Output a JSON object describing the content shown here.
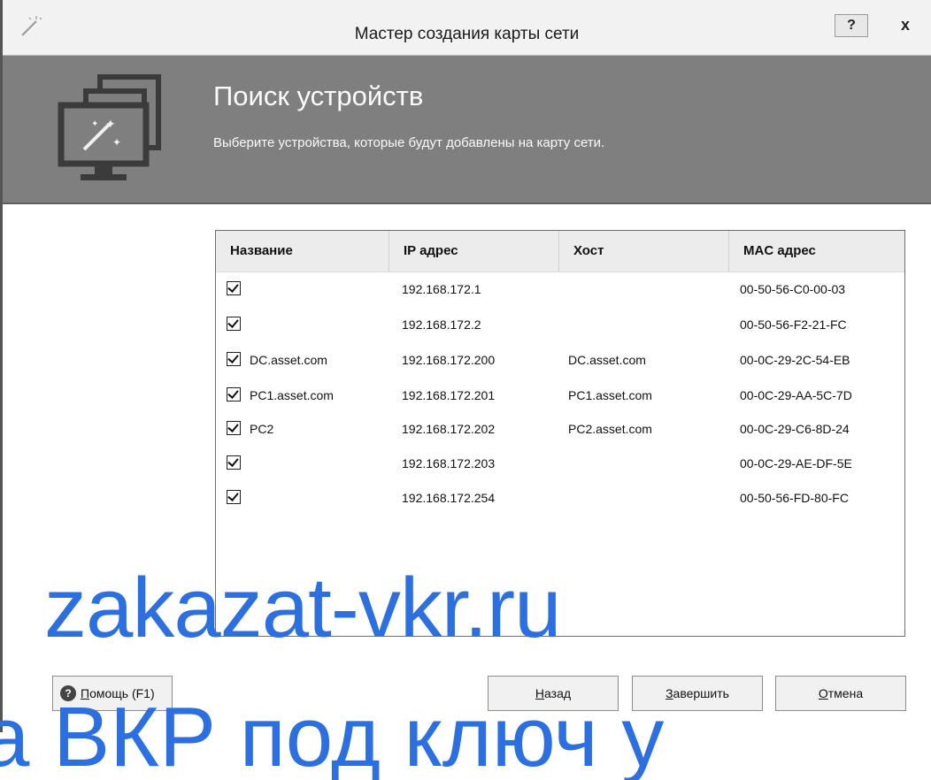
{
  "window": {
    "title": "Мастер создания карты сети",
    "help_button": "?",
    "close_button": "x"
  },
  "header": {
    "title": "Поиск устройств",
    "subtitle": "Выберите устройства, которые будут добавлены на карту сети."
  },
  "table": {
    "columns": [
      "Название",
      "IP адрес",
      "Хост",
      "MAC адрес"
    ],
    "rows": [
      {
        "checked": true,
        "name": "",
        "ip": "192.168.172.1",
        "host": "",
        "mac": "00-50-56-C0-00-03"
      },
      {
        "checked": true,
        "name": "",
        "ip": "192.168.172.2",
        "host": "",
        "mac": "00-50-56-F2-21-FC"
      },
      {
        "checked": true,
        "name": "DC.asset.com",
        "ip": "192.168.172.200",
        "host": "DC.asset.com",
        "mac": "00-0C-29-2C-54-EB"
      },
      {
        "checked": true,
        "name": "PC1.asset.com",
        "ip": "192.168.172.201",
        "host": "PC1.asset.com",
        "mac": "00-0C-29-AA-5C-7D"
      },
      {
        "checked": true,
        "name": "PC2",
        "ip": "192.168.172.202",
        "host": "PC2.asset.com",
        "mac": "00-0C-29-C6-8D-24"
      },
      {
        "checked": true,
        "name": "",
        "ip": "192.168.172.203",
        "host": "",
        "mac": "00-0C-29-AE-DF-5E"
      },
      {
        "checked": true,
        "name": "",
        "ip": "192.168.172.254",
        "host": "",
        "mac": "00-50-56-FD-80-FC"
      }
    ]
  },
  "buttons": {
    "help": {
      "access_key": "П",
      "rest": "омощь (F1)"
    },
    "back": {
      "access_key": "Н",
      "rest": "азад"
    },
    "finish": {
      "access_key": "З",
      "rest": "авершить"
    },
    "cancel": {
      "access_key": "О",
      "rest": "тмена"
    }
  },
  "watermark": {
    "line1": "zakazat-vkr.ru",
    "line2": "a ВКР под ключ у"
  },
  "icons": {
    "title_icon": "magic-wand-icon",
    "header_icon": "network-map-wizard-icon",
    "help_icon": "question-circle-icon"
  },
  "colors": {
    "header_bg": "#7f7f7f",
    "watermark": "#2b6fe0"
  }
}
